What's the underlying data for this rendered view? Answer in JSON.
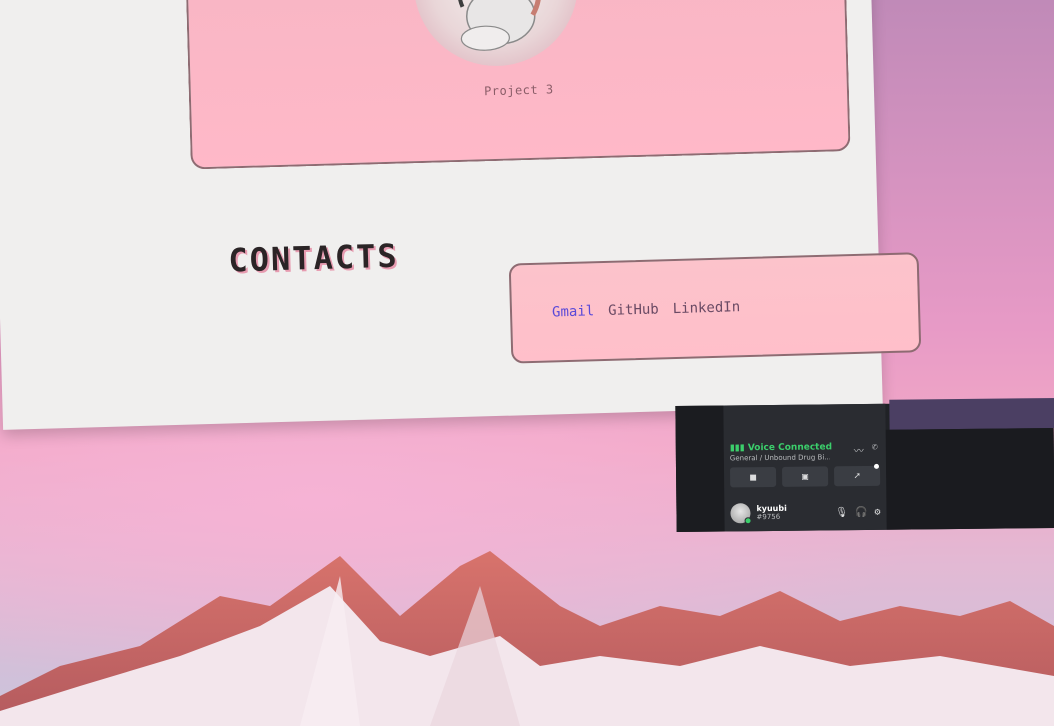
{
  "project": {
    "label": "Project 3"
  },
  "contacts": {
    "title": "CONTACTS",
    "links": [
      "Gmail",
      "GitHub",
      "LinkedIn"
    ]
  },
  "discord": {
    "voice_status": "Voice Connected",
    "channel": "General / Unbound Drug Bi...",
    "buttons": [
      "video-icon",
      "screen-share-icon",
      "activity-icon"
    ],
    "user": {
      "name": "kyuubi",
      "tag": "#9756"
    },
    "status_color": "#3bce6b"
  },
  "colors": {
    "card_pink": "#ffb8c8",
    "link_active": "#5a4ad8",
    "link": "#6a4a64"
  }
}
